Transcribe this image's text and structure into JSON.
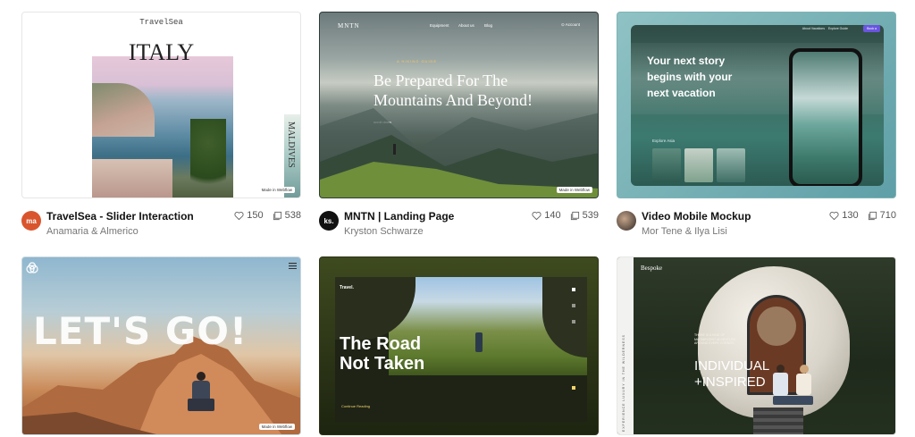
{
  "cards": [
    {
      "title": "TravelSea - Slider Interaction",
      "author": "Anamaria & Almerico",
      "likes": "150",
      "views": "538",
      "avatar_text": "ma",
      "avatar_color": "#d9552e",
      "thumb": {
        "brand": "TravelSea",
        "headline": "ITALY",
        "side_word": "MALDIVES",
        "badge": "Made in Webflow"
      }
    },
    {
      "title": "MNTN | Landing Page",
      "author": "Kryston Schwarze",
      "likes": "140",
      "views": "539",
      "avatar_text": "ks.",
      "avatar_color": "#111111",
      "thumb": {
        "brand": "MNTN",
        "nav": [
          "Equipment",
          "About us",
          "Blog"
        ],
        "account": "Account",
        "eyebrow": "A HIKING GUIDE",
        "headline_1": "Be Prepared For The",
        "headline_2": "Mountains And Beyond!",
        "scroll": "scroll down",
        "badge": "Made in Webflow"
      }
    },
    {
      "title": "Video Mobile Mockup",
      "author": "Mor Tene & Ilya Lisi",
      "likes": "130",
      "views": "710",
      "avatar_text": "",
      "avatar_color": "#6b5a4e",
      "thumb": {
        "headline_1": "Your next story",
        "headline_2": "begins with your",
        "headline_3": "next vacation",
        "explore": "Explore Asia",
        "nav": [
          "About Vacations",
          "Explore Guide"
        ],
        "cta": "Book a"
      }
    },
    {
      "title": "",
      "author": "",
      "likes": "",
      "views": "",
      "thumb": {
        "headline": "LET'S GO!",
        "badge": "Made in Webflow"
      }
    },
    {
      "title": "",
      "author": "",
      "likes": "",
      "views": "",
      "thumb": {
        "brand": "Travel.",
        "headline_1": "The Road",
        "headline_2": "Not Taken",
        "cta": "Continue Reading"
      }
    },
    {
      "title": "",
      "author": "",
      "likes": "",
      "views": "",
      "thumb": {
        "brand": "Bespoke",
        "quote": "THERE IS A KIND OF MAGNIFICENT ADVENTURE AROUND EVERY CORNER.",
        "headline_1": "INDIVIDUAL",
        "headline_2": "+INSPIRED",
        "side_text": "EXPERIENCE LUXURY IN THE WILDERNESS"
      }
    }
  ],
  "icons": {
    "like": "heart-icon",
    "views": "stack-icon",
    "menu": "hamburger-icon"
  }
}
